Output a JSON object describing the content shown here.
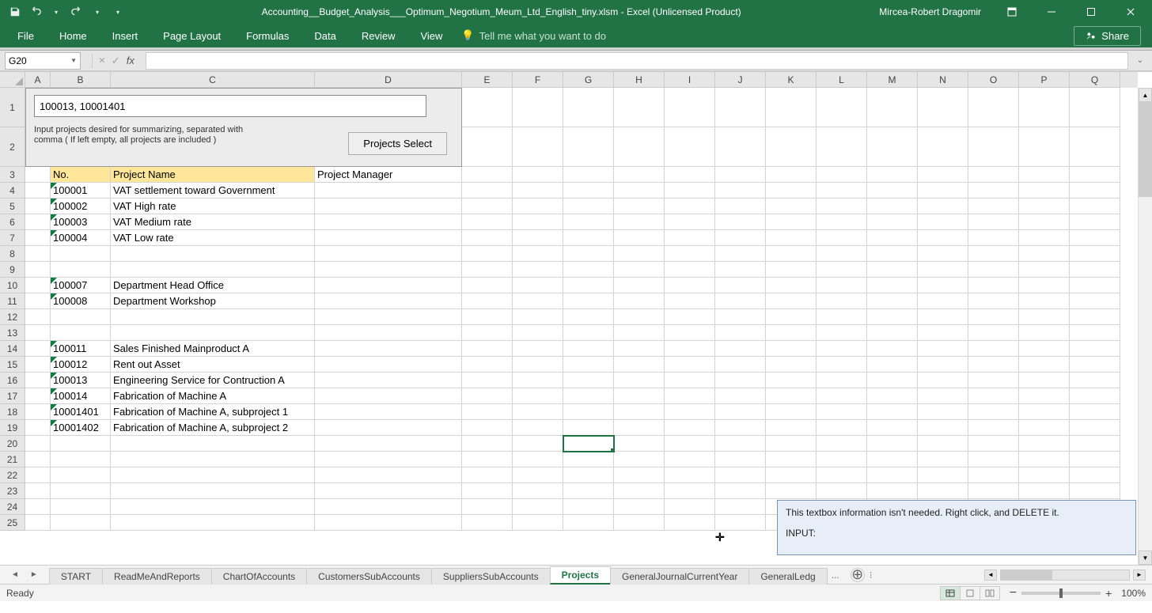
{
  "window": {
    "title": "Accounting__Budget_Analysis___Optimum_Negotium_Meum_Ltd_English_tiny.xlsm - Excel (Unlicensed Product)",
    "user": "Mircea-Robert Dragomir"
  },
  "ribbon": {
    "tabs": [
      "File",
      "Home",
      "Insert",
      "Page Layout",
      "Formulas",
      "Data",
      "Review",
      "View"
    ],
    "tellme": "Tell me what you want to do",
    "share": "Share"
  },
  "formula": {
    "namebox": "G20",
    "value": ""
  },
  "columns": [
    "A",
    "B",
    "C",
    "D",
    "E",
    "F",
    "G",
    "H",
    "I",
    "J",
    "K",
    "L",
    "M",
    "N",
    "O",
    "P",
    "Q"
  ],
  "row_labels": [
    "1",
    "2",
    "3",
    "4",
    "5",
    "6",
    "7",
    "8",
    "9",
    "10",
    "11",
    "12",
    "13",
    "14",
    "15",
    "16",
    "17",
    "18",
    "19",
    "20",
    "21",
    "22",
    "23",
    "24",
    "25"
  ],
  "form": {
    "input_value": "100013, 10001401",
    "hint": "Input projects desired for summarizing, separated with comma ( If left empty, all projects are included )",
    "button": "Projects Select"
  },
  "headers": {
    "no": "No.",
    "name": "Project Name",
    "manager": "Project Manager"
  },
  "rows": [
    {
      "no": "100001",
      "name": "VAT settlement toward Government"
    },
    {
      "no": "100002",
      "name": "VAT High rate"
    },
    {
      "no": "100003",
      "name": "VAT Medium rate"
    },
    {
      "no": "100004",
      "name": "VAT Low rate"
    },
    {
      "no": "",
      "name": ""
    },
    {
      "no": "",
      "name": ""
    },
    {
      "no": "100007",
      "name": "Department Head Office"
    },
    {
      "no": "100008",
      "name": "Department Workshop"
    },
    {
      "no": "",
      "name": ""
    },
    {
      "no": "",
      "name": ""
    },
    {
      "no": "100011",
      "name": "Sales Finished Mainproduct A"
    },
    {
      "no": "100012",
      "name": "Rent out Asset"
    },
    {
      "no": "100013",
      "name": "Engineering Service for Contruction A"
    },
    {
      "no": "100014",
      "name": "Fabrication of  Machine A"
    },
    {
      "no": "10001401",
      "name": "Fabrication of  Machine A, subproject 1"
    },
    {
      "no": "10001402",
      "name": "Fabrication of  Machine A, subproject 2"
    }
  ],
  "infobox": {
    "line1": "This textbox information isn't needed. Right click, and DELETE it.",
    "line2": "INPUT:"
  },
  "sheets": {
    "tabs": [
      "START",
      "ReadMeAndReports",
      "ChartOfAccounts",
      "CustomersSubAccounts",
      "SuppliersSubAccounts",
      "Projects",
      "GeneralJournalCurrentYear",
      "GeneralLedg"
    ],
    "active": "Projects",
    "more": "..."
  },
  "status": {
    "ready": "Ready",
    "zoom": "100%"
  }
}
